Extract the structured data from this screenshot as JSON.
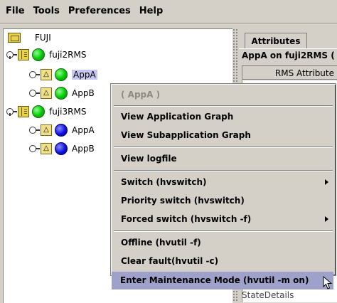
{
  "menubar": {
    "items": [
      "File",
      "Tools",
      "Preferences",
      "Help"
    ]
  },
  "tree": {
    "root_label": "FUJI",
    "nodes": [
      {
        "label": "fuji2RMS",
        "apps": [
          {
            "label": "AppA",
            "selected": true,
            "status": "green"
          },
          {
            "label": "AppB",
            "status": "green"
          }
        ]
      },
      {
        "label": "fuji3RMS",
        "apps": [
          {
            "label": "AppA",
            "status": "blue"
          },
          {
            "label": "AppB",
            "status": "blue"
          }
        ]
      }
    ]
  },
  "right_panel": {
    "tab_label": "Attributes",
    "title": "AppA on fuji2RMS (",
    "column_header": "RMS Attribute",
    "peek_text": "StateDetails"
  },
  "context_menu": {
    "header": "( AppA )",
    "items": [
      {
        "label": "View Application Graph"
      },
      {
        "label": "View Subapplication Graph"
      },
      {
        "label": "View logfile"
      },
      {
        "label": "Switch (hvswitch)",
        "submenu": true
      },
      {
        "label": "Priority switch (hvswitch)"
      },
      {
        "label": "Forced switch (hvswitch -f)",
        "submenu": true
      },
      {
        "label": "Offline (hvutil -f)"
      },
      {
        "label": "Clear fault(hvutil -c)"
      },
      {
        "label": "Enter Maintenance Mode (hvutil -m on)",
        "highlighted": true
      }
    ]
  },
  "colors": {
    "highlight": "#9ea2cb",
    "selection": "#c6c6f0",
    "online": "#00c800",
    "offline": "#1010e0",
    "panel": "#d4d0c8"
  }
}
